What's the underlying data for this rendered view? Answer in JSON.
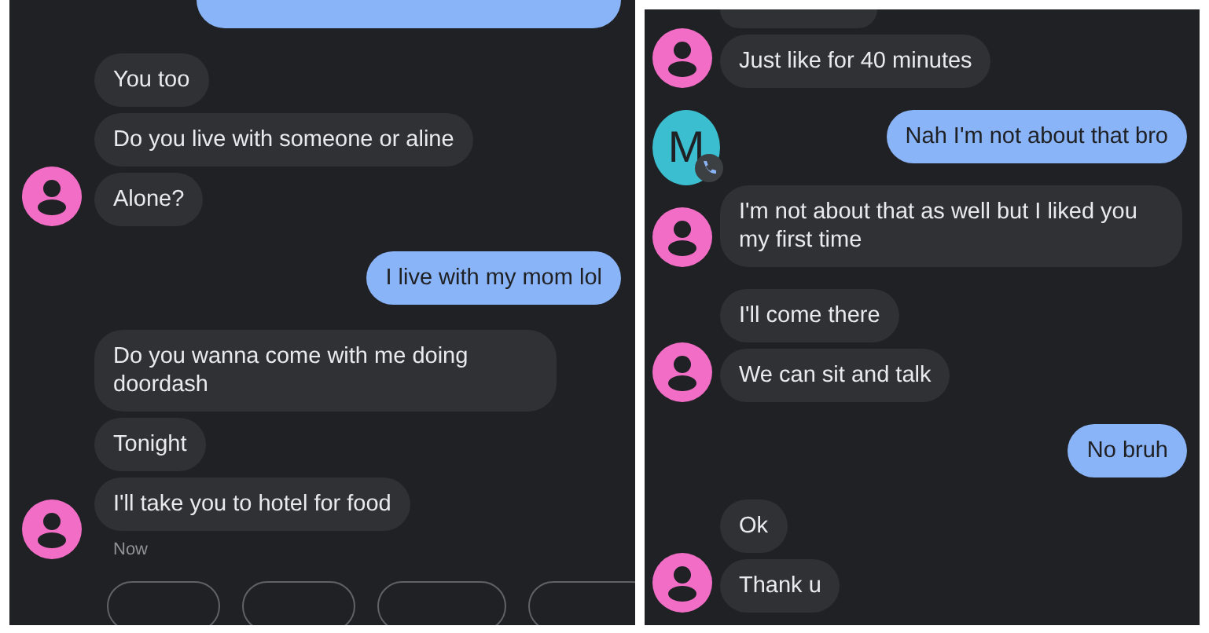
{
  "panels": [
    {
      "groups": [
        {
          "kind": "outgoing",
          "messages": [
            {
              "kind": "clipped"
            }
          ]
        },
        {
          "kind": "incoming",
          "avatar": true,
          "messages": [
            {
              "kind": "text",
              "text": "You too"
            },
            {
              "kind": "text",
              "text": "Do you live with someone or aline"
            },
            {
              "kind": "text",
              "text": "Alone?"
            }
          ]
        },
        {
          "kind": "outgoing",
          "messages": [
            {
              "kind": "text",
              "text": "I live with my mom lol"
            }
          ]
        },
        {
          "kind": "incoming",
          "avatar": true,
          "time": "Now",
          "messages": [
            {
              "kind": "text",
              "text": "Do you wanna come with me doing doordash"
            },
            {
              "kind": "text",
              "text": "Tonight"
            },
            {
              "kind": "text",
              "text": "I'll take you to hotel for food"
            }
          ]
        }
      ],
      "suggestion_chips": [
        {
          "kind": "chip"
        },
        {
          "kind": "chip"
        },
        {
          "kind": "chip"
        },
        {
          "kind": "chip"
        }
      ]
    },
    {
      "groups": [
        {
          "kind": "incoming",
          "avatar": true,
          "messages": [
            {
              "kind": "clipped"
            },
            {
              "kind": "text",
              "text": "Just like for 40 minutes"
            }
          ]
        },
        {
          "kind": "outgoing",
          "contact_avatar": "M",
          "messages": [
            {
              "kind": "text",
              "text": "Nah I'm not about that bro"
            }
          ]
        },
        {
          "kind": "incoming",
          "avatar": true,
          "messages": [
            {
              "kind": "text",
              "text": "I'm not about that as well but I liked you my first time"
            }
          ]
        },
        {
          "kind": "incoming",
          "avatar": true,
          "messages": [
            {
              "kind": "text",
              "text": "I'll come there"
            },
            {
              "kind": "text",
              "text": "We can sit and talk"
            }
          ]
        },
        {
          "kind": "outgoing",
          "messages": [
            {
              "kind": "text",
              "text": "No bruh"
            }
          ]
        },
        {
          "kind": "incoming",
          "avatar": true,
          "messages": [
            {
              "kind": "text",
              "text": "Ok"
            },
            {
              "kind": "text",
              "text": "Thank u"
            }
          ]
        }
      ]
    }
  ]
}
